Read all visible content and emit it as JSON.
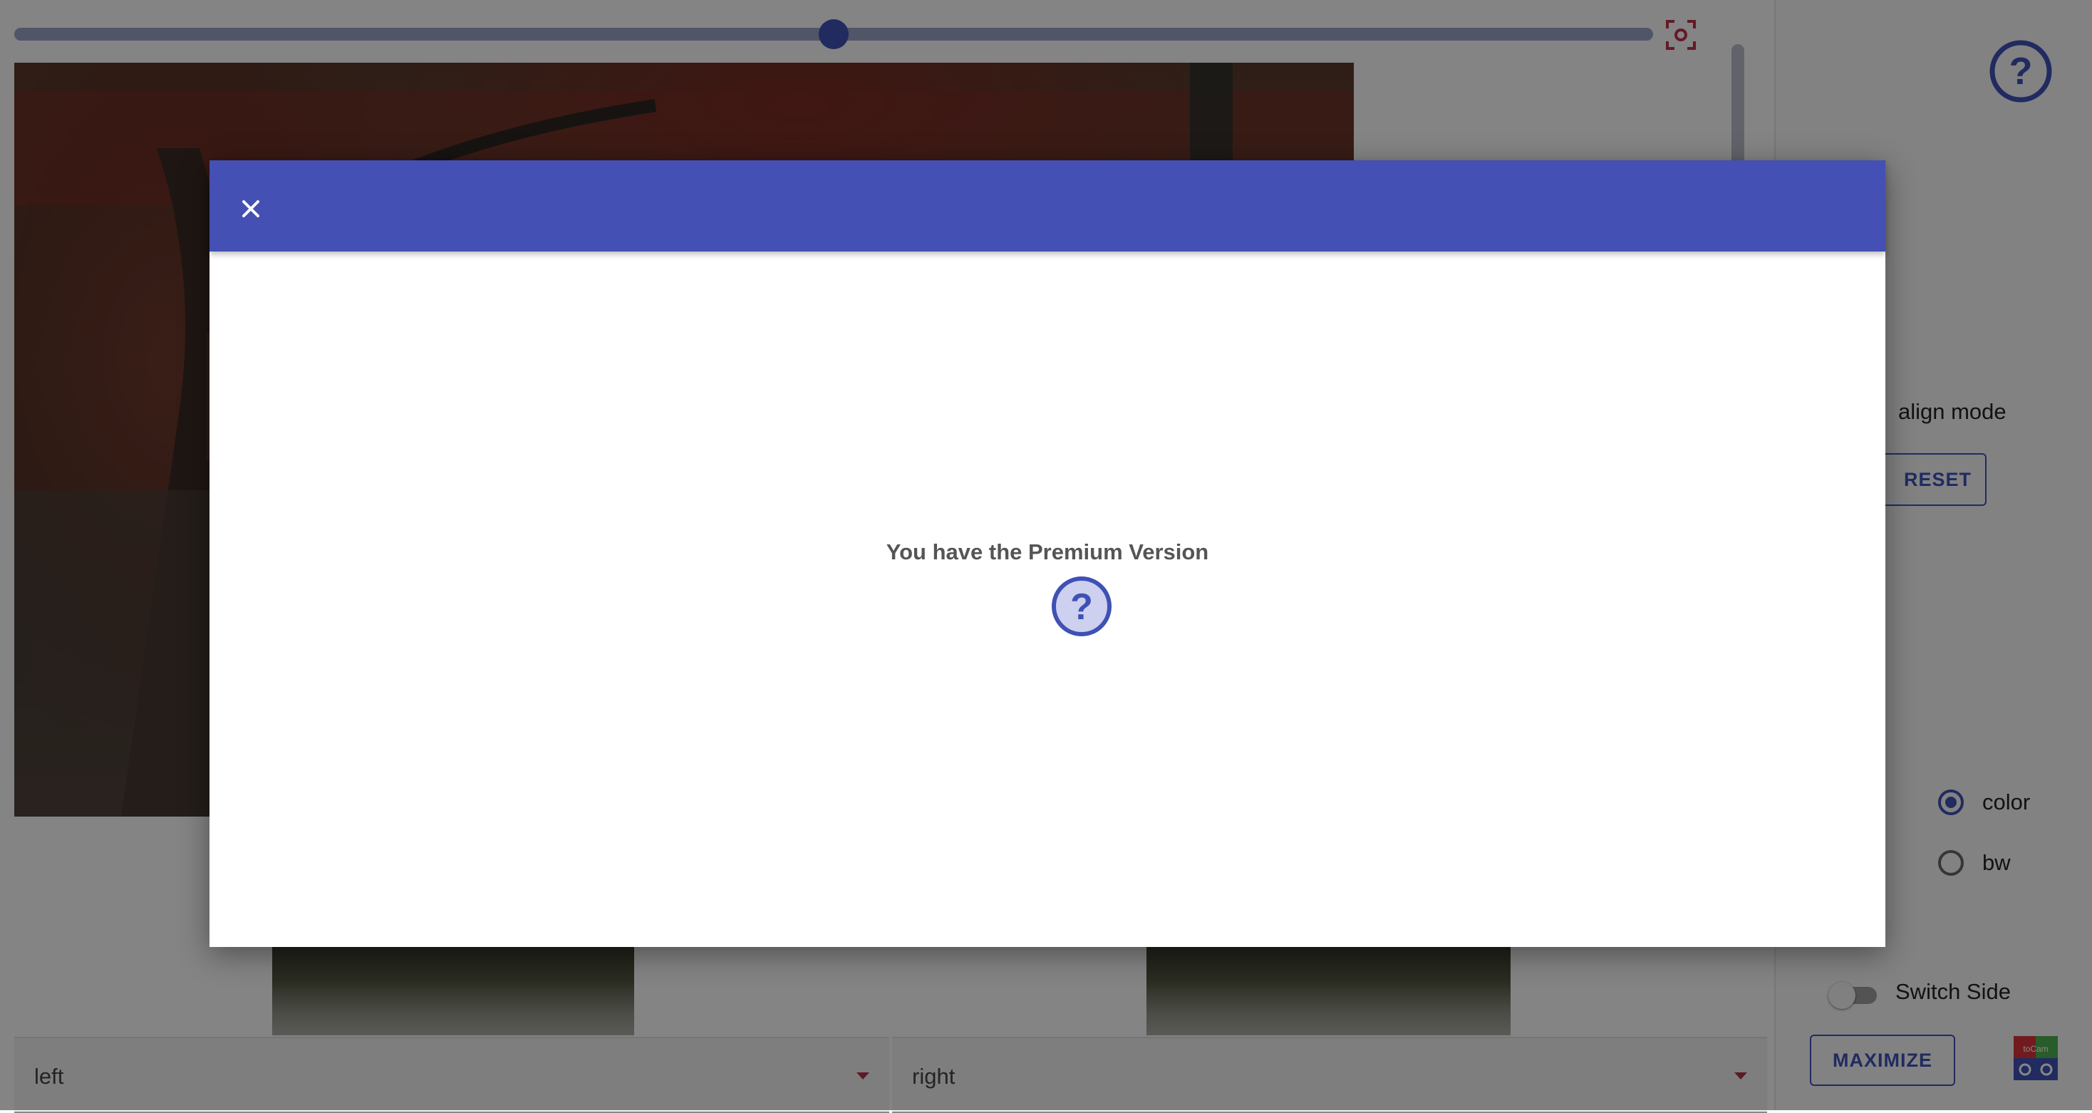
{
  "main": {
    "slider_value": 0.5,
    "left_select": {
      "value": "left"
    },
    "right_select": {
      "value": "right"
    }
  },
  "side_panel": {
    "align_mode_label": "align mode",
    "reset_label": "RESET",
    "color_options": [
      {
        "label": "color",
        "selected": true
      },
      {
        "label": "bw",
        "selected": false
      }
    ],
    "switch_side_label": "Switch Side",
    "switch_side_on": false,
    "maximize_label": "MAXIMIZE",
    "logo_text": "toCam"
  },
  "dialog": {
    "message": "You have the Premium Version"
  },
  "colors": {
    "accent": "#3f51b5",
    "dialog_header": "#4450b3",
    "focus_icon": "#c0304a",
    "backdrop": "rgba(0,0,0,0.47)"
  },
  "icons": [
    "close-icon",
    "help-icon",
    "focus-frame-icon",
    "dropdown-arrow-icon",
    "tocam-logo-icon"
  ]
}
